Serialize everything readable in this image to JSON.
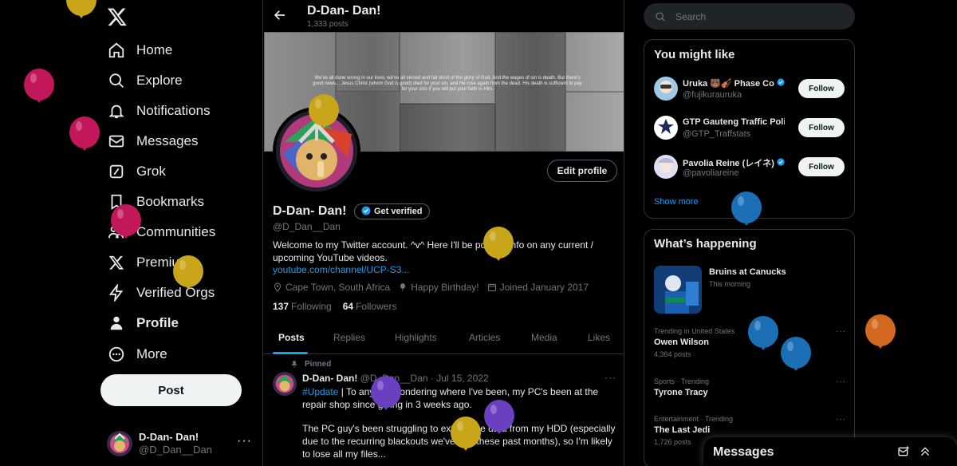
{
  "colors": {
    "accent": "#1d9bf0",
    "bg": "#000000",
    "muted": "#71767b",
    "border": "#2f3336"
  },
  "nav": {
    "items": [
      {
        "label": "Home",
        "icon": "home-icon"
      },
      {
        "label": "Explore",
        "icon": "search-icon"
      },
      {
        "label": "Notifications",
        "icon": "bell-icon"
      },
      {
        "label": "Messages",
        "icon": "envelope-icon"
      },
      {
        "label": "Grok",
        "icon": "grok-icon"
      },
      {
        "label": "Bookmarks",
        "icon": "bookmark-icon"
      },
      {
        "label": "Communities",
        "icon": "people-icon"
      },
      {
        "label": "Premium",
        "icon": "x-icon"
      },
      {
        "label": "Verified Orgs",
        "icon": "lightning-icon"
      },
      {
        "label": "Profile",
        "icon": "person-icon"
      },
      {
        "label": "More",
        "icon": "more-circle-icon"
      }
    ],
    "post_label": "Post",
    "account": {
      "name": "D-Dan- Dan!",
      "handle": "@D_Dan__Dan",
      "more": "···"
    }
  },
  "profile": {
    "top_name": "D-Dan- Dan!",
    "post_count": "1,333 posts",
    "banner_text": "We've all done wrong in our lives; we've all sinned and fall short of the glory of God. And the wages of sin is death. But there's good news... Jesus Christ (whom God is good) died for your sin, and He rose again from the dead. His death is sufficient to pay for your sins if you will put your faith in Him.",
    "edit_label": "Edit profile",
    "name": "D-Dan- Dan!",
    "get_verified": "Get verified",
    "handle": "@D_Dan__Dan",
    "bio": "Welcome to my Twitter account. ^v^ Here I'll be posting info on any current / upcoming YouTube videos.",
    "link": "youtube.com/channel/UCP-S3...",
    "location": "Cape Town, South Africa",
    "birthday": "Happy Birthday!",
    "joined": "Joined January 2017",
    "following_count": "137",
    "following_label": "Following",
    "followers_count": "64",
    "followers_label": "Followers"
  },
  "tabs": [
    "Posts",
    "Replies",
    "Highlights",
    "Articles",
    "Media",
    "Likes"
  ],
  "tweet": {
    "pinned_label": "Pinned",
    "name": "D-Dan- Dan!",
    "handle_date": "@D_Dan__Dan · Jul 15, 2022",
    "more": "···",
    "hashtag": "#Update",
    "para1": " | To anyone wondering where I've been, my PC's been at the repair shop since giving in 3 weeks ago.",
    "para2": "The PC guy's been struggling to extract the data from my HDD (especially due to the recurring blackouts we've had these past months), so I'm likely to lose all my files..."
  },
  "search": {
    "placeholder": "Search"
  },
  "suggestions": {
    "title": "You might like",
    "follow_label": "Follow",
    "show_more": "Show more",
    "items": [
      {
        "name": "Uruka 🐻🎻 Phase Co",
        "handle": "@fujikurauruka",
        "verified": true
      },
      {
        "name": "GTP Gauteng Traffic Polic",
        "handle": "@GTP_Traffstats",
        "verified": false
      },
      {
        "name": "Pavolia Reine (レイネ)",
        "handle": "@pavoliareine",
        "verified": true
      }
    ]
  },
  "happening": {
    "title": "What’s happening",
    "event": {
      "title": "Bruins at Canucks",
      "sub": "This morning"
    },
    "trends": [
      {
        "context": "Trending in United States",
        "name": "Owen Wilson",
        "count": "4,364 posts"
      },
      {
        "context": "Sports · Trending",
        "name": "Tyrone Tracy",
        "count": ""
      },
      {
        "context": "Entertainment · Trending",
        "name": "The Last Jedi",
        "count": "1,726 posts"
      }
    ],
    "more": "···"
  },
  "messages_drawer": {
    "title": "Messages"
  },
  "balloons": [
    {
      "color": "#c9a51a"
    },
    {
      "color": "#c2185b"
    },
    {
      "color": "#c2185b"
    },
    {
      "color": "#c2185b"
    },
    {
      "color": "#c9a51a"
    },
    {
      "color": "#c9a51a"
    },
    {
      "color": "#c9a51a"
    },
    {
      "color": "#6a3fc0"
    },
    {
      "color": "#6a3fc0"
    },
    {
      "color": "#c9a51a"
    },
    {
      "color": "#1a6fb5"
    },
    {
      "color": "#1a6fb5"
    },
    {
      "color": "#1a6fb5"
    },
    {
      "color": "#d2691e"
    }
  ]
}
